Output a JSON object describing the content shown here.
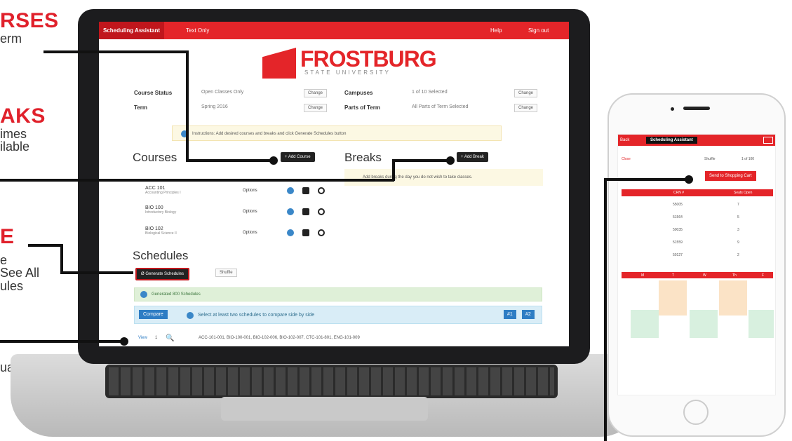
{
  "promo": {
    "courses_h": "RSES",
    "courses_t": "erm",
    "breaks_h": "AKS",
    "breaks_t1": "imes",
    "breaks_t2": "ilable",
    "e_h": "E",
    "e_t1": "e",
    "e_t2": "See All",
    "e_t3": "ules",
    "ual": "ual"
  },
  "app": {
    "title": "Scheduling Assistant",
    "text_only": "Text Only",
    "help": "Help",
    "sign_out": "Sign out"
  },
  "logo": {
    "name": "FROSTBURG",
    "sub": "STATE UNIVERSITY"
  },
  "filters": {
    "course_status_label": "Course Status",
    "course_status_value": "Open Classes Only",
    "term_label": "Term",
    "term_value": "Spring 2016",
    "campuses_label": "Campuses",
    "campuses_value": "1 of 10 Selected",
    "parts_label": "Parts of Term",
    "parts_value": "All Parts of Term Selected",
    "change": "Change"
  },
  "instructions": "Instructions: Add desired courses and breaks and click Generate Schedules button",
  "courses": {
    "title": "Courses",
    "add": "+ Add Course",
    "options": "Options",
    "items": [
      {
        "code": "ACC 101",
        "name": "Accounting Principles I"
      },
      {
        "code": "BIO 100",
        "name": "Introductory Biology"
      },
      {
        "code": "BIO 102",
        "name": "Biological Science II"
      }
    ]
  },
  "breaks": {
    "title": "Breaks",
    "add": "+ Add Break",
    "hint": "Add breaks during the day you do not wish to take classes."
  },
  "schedules": {
    "title": "Schedules",
    "generate": "Ø Generate Schedules",
    "shuffle": "Shuffle",
    "generated": "Generated 800 Schedules",
    "compare": "Compare",
    "compare_hint": "Select at least two schedules to compare side by side",
    "n1": "#1",
    "n2": "#2",
    "view": "View",
    "view_num": "1",
    "view_list": "ACC-101-001, BIO-100-001, BIO-102-006, BIO-102-007, CTC-101-801, ENG-101-009"
  },
  "phone": {
    "back": "Back",
    "title": "Scheduling Assistant",
    "close": "Close",
    "shuffle": "Shuffle",
    "count": "1 of 100",
    "send": "Send to Shopping Cart",
    "crn": "CRN #",
    "seats": "Seats Open",
    "rows": [
      {
        "crn": "55005",
        "seats": "7"
      },
      {
        "crn": "51564",
        "seats": "5"
      },
      {
        "crn": "50035",
        "seats": "3"
      },
      {
        "crn": "51559",
        "seats": "9"
      },
      {
        "crn": "50127",
        "seats": "2"
      }
    ],
    "days": [
      "M",
      "T",
      "W",
      "Th",
      "F"
    ]
  }
}
